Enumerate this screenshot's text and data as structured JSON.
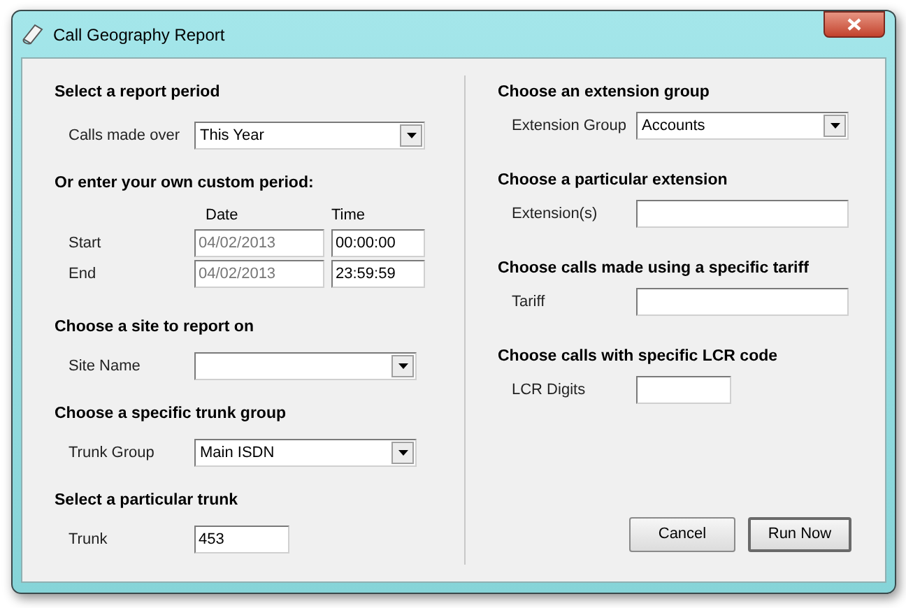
{
  "window": {
    "title": "Call Geography Report"
  },
  "report_period": {
    "heading": "Select a report period",
    "label": "Calls made over",
    "value": "This Year"
  },
  "custom_period": {
    "heading": "Or enter your own custom period:",
    "date_header": "Date",
    "time_header": "Time",
    "rows": [
      {
        "label": "Start",
        "date": {
          "value": "04/02/2013",
          "disabled": true
        },
        "time": {
          "value": "00:00:00",
          "disabled": false
        }
      },
      {
        "label": "End",
        "date": {
          "value": "04/02/2013",
          "disabled": true
        },
        "time": {
          "value": "23:59:59",
          "disabled": false
        }
      }
    ]
  },
  "left_sections": [
    {
      "heading": "Choose a site to report on",
      "label": "Site Name",
      "kind": "dropdown"
    },
    {
      "heading": "Choose a specific trunk group",
      "label": "Trunk Group",
      "kind": "dropdown",
      "value": "Main ISDN"
    },
    {
      "heading": "Select a particular trunk",
      "label": "Trunk",
      "kind": "short_text",
      "value": "453"
    }
  ],
  "right_sections": [
    {
      "heading": "Choose an extension group",
      "label": "Extension Group",
      "kind": "dropdown",
      "value": "Accounts"
    },
    {
      "heading": "Choose a particular extension",
      "label": "Extension(s)",
      "kind": "text"
    },
    {
      "heading": "Choose calls made using a specific tariff",
      "label": "Tariff",
      "kind": "text"
    },
    {
      "heading": "Choose calls with specific LCR code",
      "label": "LCR Digits",
      "kind": "short_text"
    }
  ],
  "buttons": [
    {
      "label": "Cancel",
      "default": false
    },
    {
      "label": "Run Now",
      "default": true
    }
  ]
}
